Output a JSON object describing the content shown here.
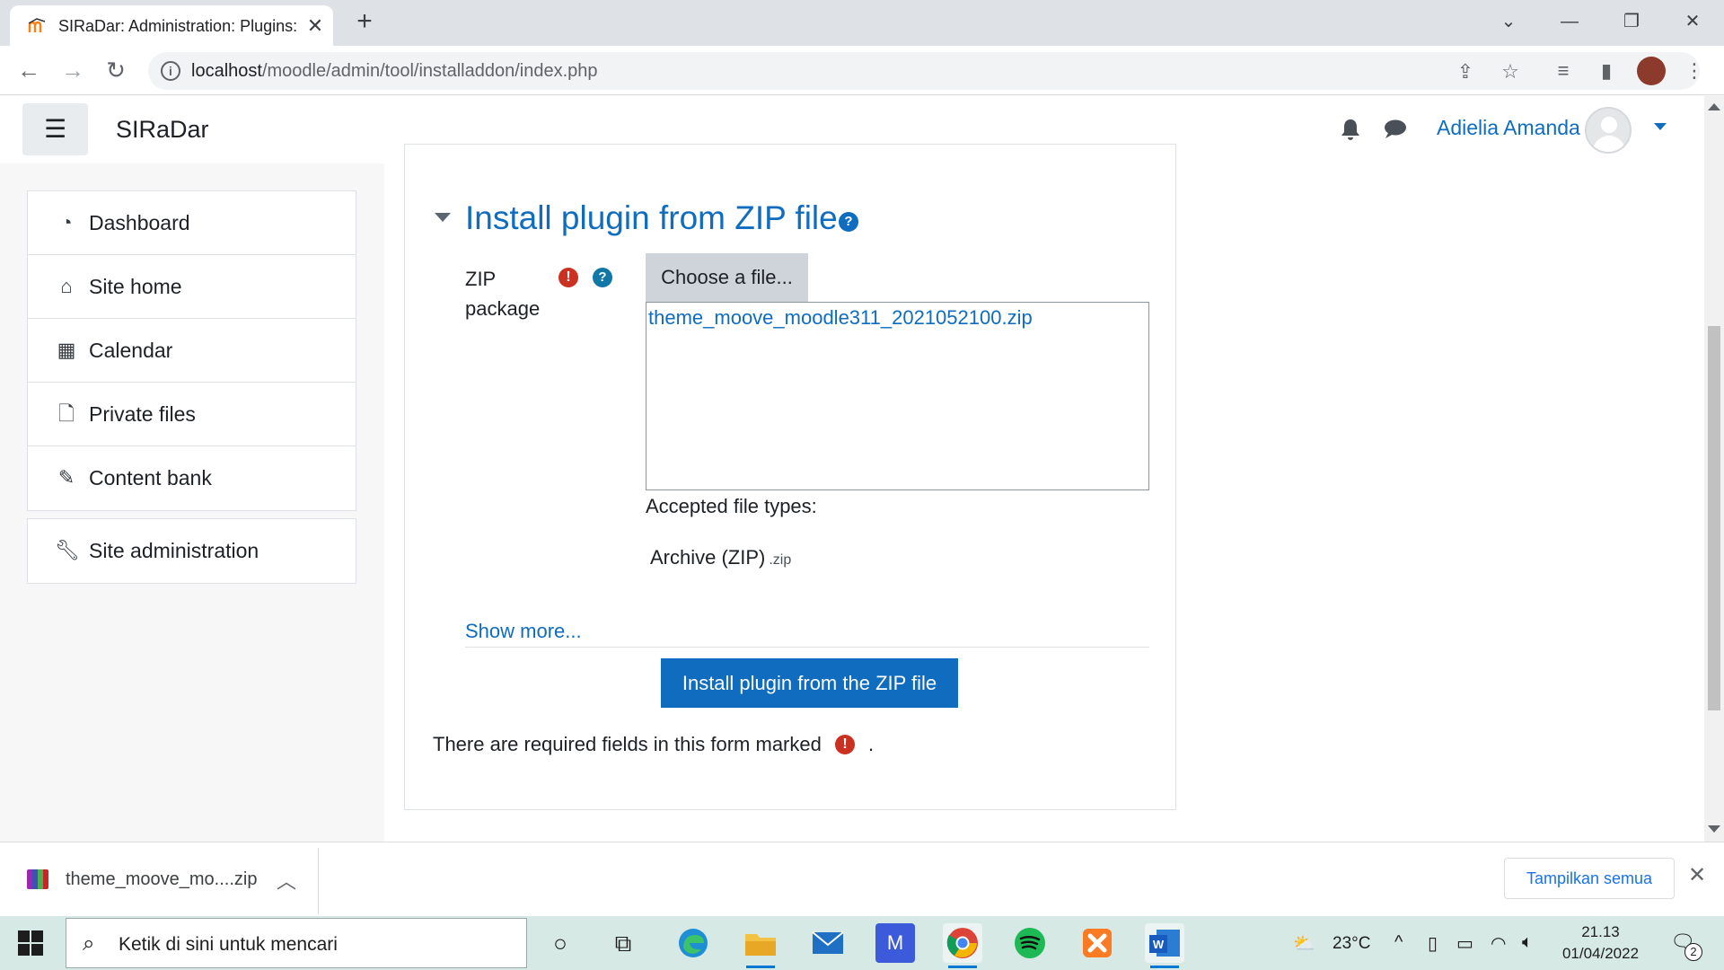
{
  "browser": {
    "tab_title": "SIRaDar: Administration: Plugins: Install plugins",
    "url_host": "localhost",
    "url_path": "/moodle/admin/tool/installaddon/index.php"
  },
  "navbar": {
    "brand": "SIRaDar",
    "user_name": "Adielia Amanda"
  },
  "drawer": {
    "items": [
      {
        "label": "Dashboard",
        "icon": "dashboard-icon"
      },
      {
        "label": "Site home",
        "icon": "home-icon"
      },
      {
        "label": "Calendar",
        "icon": "calendar-icon"
      },
      {
        "label": "Private files",
        "icon": "file-icon"
      },
      {
        "label": "Content bank",
        "icon": "brush-icon"
      }
    ],
    "admin_item": {
      "label": "Site administration",
      "icon": "wrench-icon"
    }
  },
  "form": {
    "section_title": "Install plugin from ZIP file",
    "field_label": "ZIP package",
    "choose_button": "Choose a file...",
    "selected_file": "theme_moove_moodle311_2021052100.zip",
    "accepted_label": "Accepted file types:",
    "filetype_name": "Archive (ZIP)",
    "filetype_ext": ".zip",
    "show_more": "Show more...",
    "submit_button": "Install plugin from the ZIP file",
    "required_note": "There are required fields in this form marked",
    "required_note_end": "."
  },
  "download_shelf": {
    "file_name": "theme_moove_mo....zip",
    "show_all": "Tampilkan semua"
  },
  "taskbar": {
    "search_placeholder": "Ketik di sini untuk mencari",
    "weather": "23°C",
    "time": "21.13",
    "date": "01/04/2022",
    "notification_count": "2"
  },
  "colors": {
    "moodle_blue": "#0f6cbf",
    "required_red": "#ca3120",
    "taskbar_bg": "#d7e9e4"
  }
}
